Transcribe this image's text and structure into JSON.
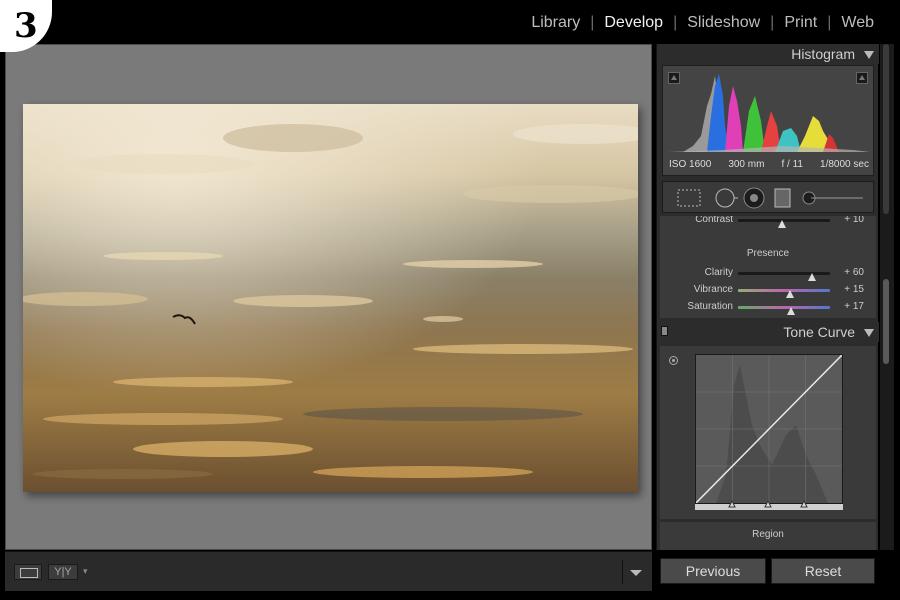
{
  "step_number": "3",
  "modules": [
    {
      "label": "Library",
      "active": false
    },
    {
      "label": "Develop",
      "active": true
    },
    {
      "label": "Slideshow",
      "active": false
    },
    {
      "label": "Print",
      "active": false
    },
    {
      "label": "Web",
      "active": false
    }
  ],
  "module_separator": "|",
  "toolbar": {
    "compare_label": "Y|Y"
  },
  "histogram": {
    "title": "Histogram",
    "iso": "ISO 1600",
    "focal_length": "300 mm",
    "aperture": "f / 11",
    "shutter": "1/8000 sec"
  },
  "basic": {
    "contrast": {
      "label": "Contrast",
      "value": "+ 10",
      "level": 0.48
    },
    "presence_title": "Presence",
    "clarity": {
      "label": "Clarity",
      "value": "+ 60",
      "level": 0.8
    },
    "vibrance": {
      "label": "Vibrance",
      "value": "+ 15",
      "level": 0.57
    },
    "saturation": {
      "label": "Saturation",
      "value": "+ 17",
      "level": 0.58
    }
  },
  "tone_curve": {
    "title": "Tone Curve",
    "region_title": "Region"
  },
  "buttons": {
    "previous": "Previous",
    "reset": "Reset"
  },
  "colors": {
    "panel_bg": "#2c2c2c",
    "viewer_bg": "#7a7a7a",
    "active_module": "#f2f2f2"
  }
}
